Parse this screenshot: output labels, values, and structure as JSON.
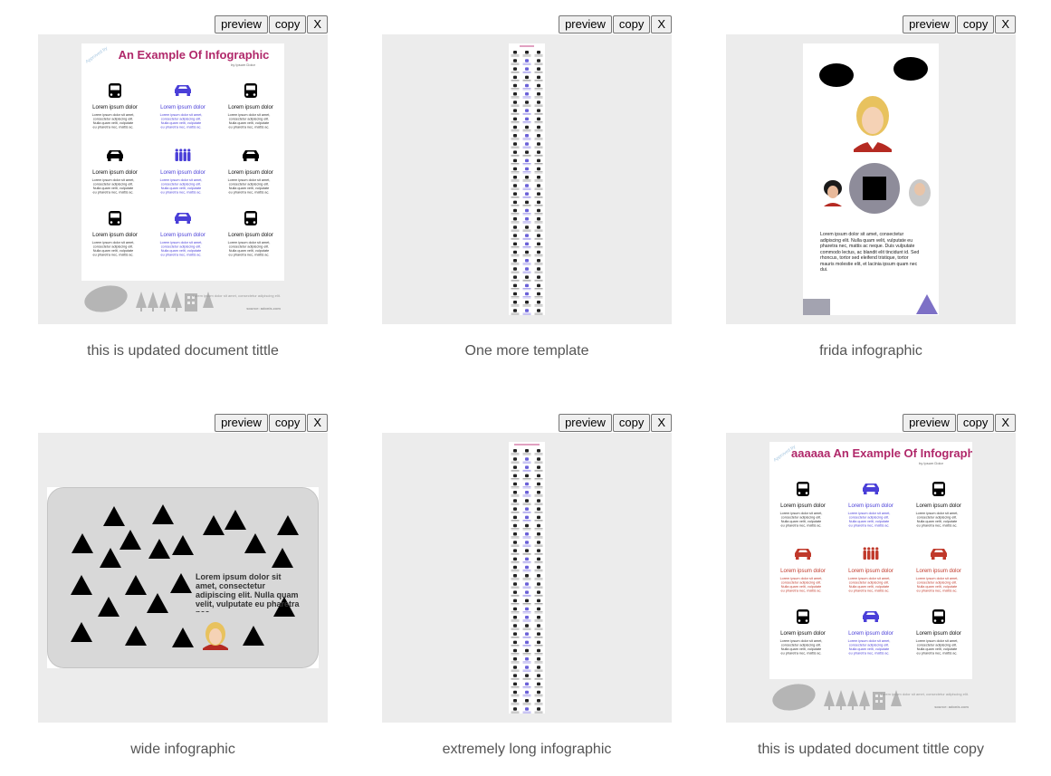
{
  "cards": [
    {
      "title": "this is updated document tittle",
      "preview_label": "preview",
      "copy_label": "copy",
      "close_label": "X",
      "thumb": {
        "heading": "An Example Of Infographic",
        "byline": "by Ipsum Dolor",
        "item_title": "Lorem ipsum dolor",
        "item_text": "Lorem ipsum dolor sit amet, consectetur adipiscing elit. Nulla quam velit, vulputate eu pharetra nec, mattis ac.",
        "footer_text": "Lorem ipsum dolor sit amet, consectetur adipiscing elit.",
        "source": "source: adonis.com"
      }
    },
    {
      "title": "One more template",
      "preview_label": "preview",
      "copy_label": "copy",
      "close_label": "X"
    },
    {
      "title": "frida infographic",
      "preview_label": "preview",
      "copy_label": "copy",
      "close_label": "X",
      "thumb": {
        "body": "Lorem ipsum dolor sit amet, consectetur adipiscing elit. Nulla quam velit, vulputate eu pharetra nec, mattis ac neque. Duis vulputate commodo lectus, ac blandit elit tincidunt id. Sed rhoncus, tortor sed eleifend tristique, tortor mauris molestie elit, et lacinia ipsum quam nec dui."
      }
    },
    {
      "title": "wide infographic",
      "preview_label": "preview",
      "copy_label": "copy",
      "close_label": "X",
      "thumb": {
        "body": "Lorem ipsum dolor sit amet, consectetur adipiscing elit. Nulla quam velit, vulputate eu pharetra nec"
      }
    },
    {
      "title": "extremely long infographic",
      "preview_label": "preview",
      "copy_label": "copy",
      "close_label": "X"
    },
    {
      "title": "this is updated document tittle copy",
      "preview_label": "preview",
      "copy_label": "copy",
      "close_label": "X",
      "thumb": {
        "heading": "aaaaaa An Example Of Infographic",
        "byline": "by Ipsum Dolor",
        "item_title": "Lorem ipsum dolor",
        "item_text": "Lorem ipsum dolor sit amet, consectetur adipiscing elit. Nulla quam velit, vulputate eu pharetra nec, mattis ac.",
        "footer_text": "Lorem ipsum dolor sit amet, consectetur adipiscing elit.",
        "source": "source: adonis.com"
      }
    }
  ],
  "colors": {
    "accent_pink": "#b0286a",
    "accent_blue": "#4a3fd8",
    "accent_red": "#c0392b",
    "thumb_bg": "#ececec"
  },
  "icons": {
    "vehicle_bus": "bus-icon",
    "vehicle_car": "car-icon",
    "people": "people-icon",
    "tree": "tree-icon",
    "building": "building-icon"
  }
}
